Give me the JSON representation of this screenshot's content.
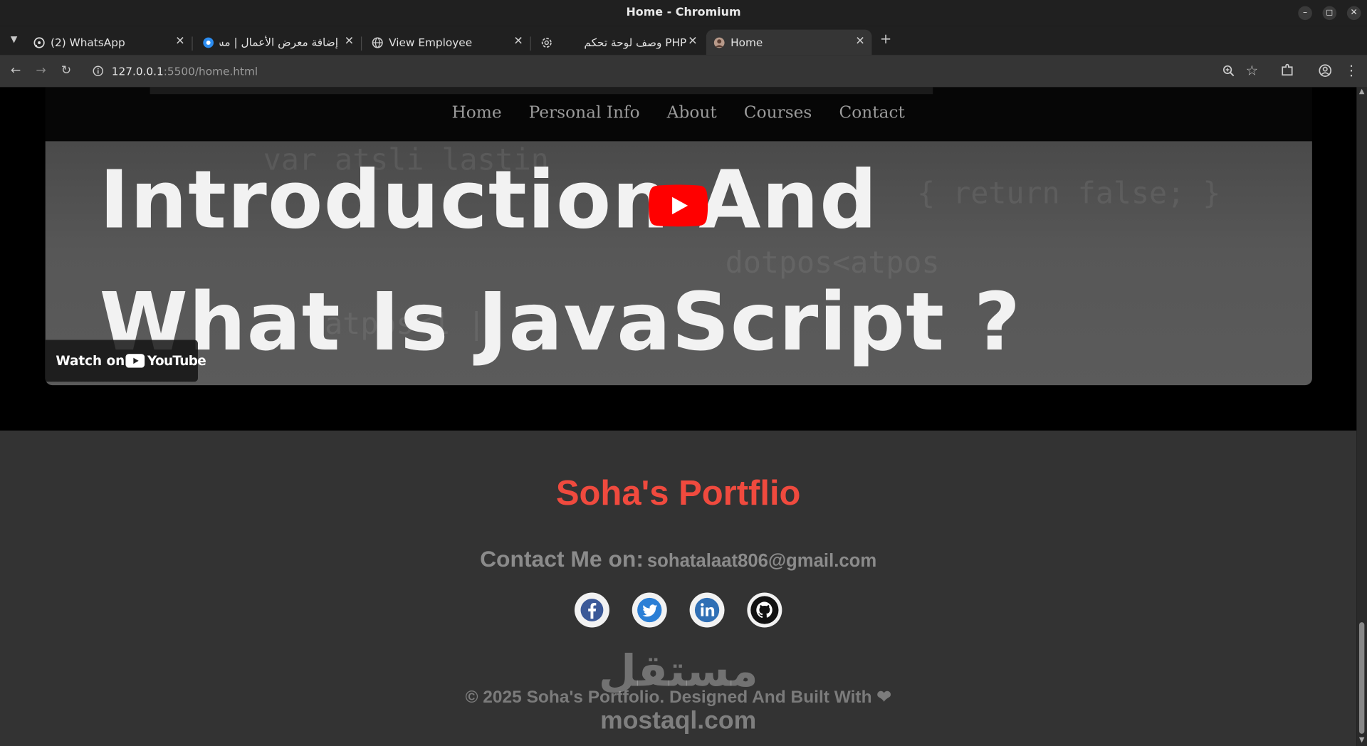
{
  "window": {
    "title": "Home - Chromium"
  },
  "tabs": [
    {
      "label": "(2) WhatsApp",
      "icon": "whatsapp-icon"
    },
    {
      "label": "إضافة معرض الأعمال | مس...",
      "icon": "mostaql-icon"
    },
    {
      "label": "View Employee",
      "icon": "globe-icon"
    },
    {
      "label": "وصف لوحة تحكم PHP",
      "icon": "chatgpt-icon"
    },
    {
      "label": "Home",
      "icon": "site-favicon",
      "active": true
    }
  ],
  "address_bar": {
    "host": "127.0.0.1",
    "path": ":5500/home.html"
  },
  "nav": {
    "items": [
      "Home",
      "Personal Info",
      "About",
      "Courses",
      "Contact"
    ]
  },
  "video": {
    "line1": "Introduction And",
    "line2": "What Is JavaScript ?",
    "watch_on": "Watch on",
    "youtube": "YouTube"
  },
  "footer": {
    "brand": "Soha's Portflio",
    "contact_label": "Contact Me on:",
    "contact_email": "sohatalaat806@gmail.com",
    "socials": [
      "facebook-icon",
      "twitter-icon",
      "linkedin-icon",
      "github-icon"
    ],
    "copyright": "© 2025 Soha's Portfolio. Designed And Built With ❤",
    "watermark_ar": "مستقل",
    "watermark_en": "mostaql.com"
  },
  "colors": {
    "brand": "#f04a3e",
    "facebook": "#3b5998",
    "twitter": "#1da1f2",
    "linkedin": "#0a66c2",
    "youtube": "#ff0000"
  }
}
